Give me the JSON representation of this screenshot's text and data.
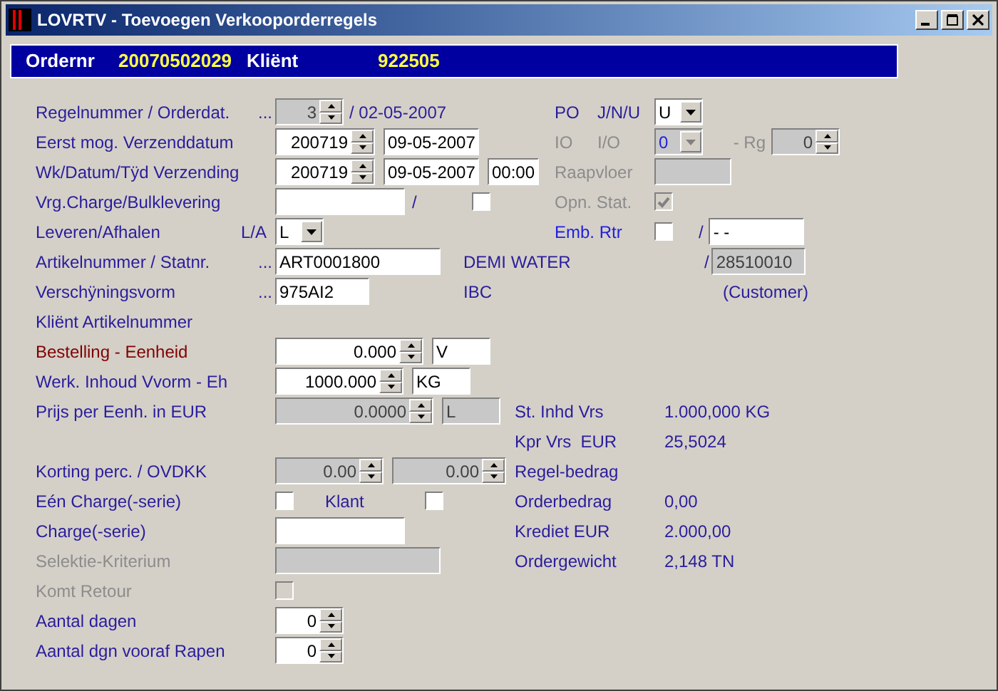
{
  "window": {
    "title": "LOVRTV - Toevoegen Verkooporderregels"
  },
  "header": {
    "order_label": "Ordernr",
    "order_number": "20070502029",
    "client_label": "Kliënt",
    "client_number": "922505"
  },
  "line": {
    "label": "Regelnummer / Orderdat.",
    "dots": "...",
    "value": "3",
    "disabled": true,
    "date": "/ 02-05-2007"
  },
  "earliest": {
    "label": "Eerst mog. Verzenddatum",
    "week": "200719",
    "date": "09-05-2007"
  },
  "shipping": {
    "label": "Wk/Datum/Tÿd Verzending",
    "week": "200719",
    "date": "09-05-2007",
    "time": "00:00"
  },
  "bulk": {
    "label": "Vrg.Charge/Bulklevering",
    "slash": "/",
    "checked": false
  },
  "delivery": {
    "label": "Leveren/Afhalen",
    "hint": "L/A",
    "value": "L"
  },
  "article": {
    "label": "Artikelnummer / Statnr.",
    "dots": "...",
    "value": "ART0001800",
    "description": "DEMI WATER",
    "slash": "/",
    "stat_number": "28510010"
  },
  "form": {
    "label": "Verschÿningsvorm",
    "dots": "...",
    "value": "975AI2",
    "description": "IBC",
    "note": "(Customer)"
  },
  "client_article": {
    "label": "Kliënt Artikelnummer"
  },
  "order_qty": {
    "label": "Bestelling - Eenheid",
    "highlight": true,
    "value": "0.000",
    "unit": "V"
  },
  "content": {
    "label": "Werk. Inhoud Vvorm - Eh",
    "value": "1000.000",
    "unit": "KG"
  },
  "price": {
    "label": "Prijs per Eenh. in EUR",
    "value": "0.0000",
    "unit": "L",
    "disabled": true
  },
  "discount": {
    "label": "Korting perc. / OVDKK",
    "value": "0.00",
    "value2": "0.00",
    "disabled": true
  },
  "single_batch": {
    "label": "Eén Charge(-serie)",
    "checked": false,
    "client_label": "Klant",
    "client_checked": false
  },
  "batch": {
    "label": "Charge(-serie)"
  },
  "selection": {
    "label": "Selektie-Kriterium",
    "disabled": true
  },
  "returns": {
    "label": "Komt Retour",
    "disabled": true,
    "checked": false
  },
  "days": {
    "label": "Aantal dagen",
    "value": "0"
  },
  "pick_days": {
    "label": "Aantal dgn vooraf Rapen",
    "value": "0"
  },
  "right": {
    "po": {
      "label": "PO",
      "hint": "J/N/U",
      "value": "U"
    },
    "io": {
      "label": "IO",
      "hint": "I/O",
      "value": "0",
      "disabled": true,
      "rg_label": "- Rg",
      "rg_value": "0"
    },
    "pick_floor": {
      "label": "Raapvloer",
      "disabled": true
    },
    "open_status": {
      "label": "Opn. Stat.",
      "checked": true,
      "disabled": true
    },
    "emb": {
      "label": "Emb. Rtr",
      "checked": false,
      "slash": "/",
      "value": "- -"
    }
  },
  "totals": [
    {
      "label": "St. Inhd Vrs",
      "value": "1.000,000 KG"
    },
    {
      "label": "Kpr Vrs  EUR",
      "value": "25,5024"
    },
    {
      "label": "Regel-bedrag"
    },
    {
      "label": "Orderbedrag",
      "value": "0,00"
    },
    {
      "label": "Krediet EUR",
      "value": "2.000,00"
    },
    {
      "label": "Ordergewicht",
      "value": "2,148 TN"
    }
  ]
}
